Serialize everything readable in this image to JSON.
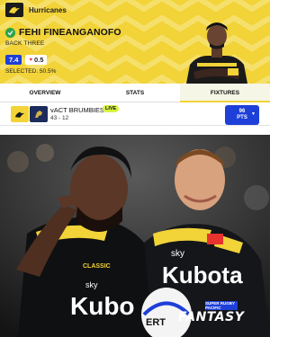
{
  "header": {
    "team_name": "Hurricanes",
    "player_name": "FEHI FINEANGANOFO",
    "position": "BACK THREE",
    "price": "7.4",
    "change": "0.5",
    "selected": "SELECTED: 50.5%",
    "accent_color": "#f2d338"
  },
  "tabs": [
    {
      "label": "OVERVIEW",
      "active": false
    },
    {
      "label": "STATS",
      "active": false
    },
    {
      "label": "FIXTURES",
      "active": true
    }
  ],
  "fixture": {
    "opponent": "vACT BRUMBIES",
    "score": "43 - 12",
    "live_label": "LIVE",
    "points_value": "96",
    "points_unit": "PTS"
  },
  "hero": {
    "brand": "FANTASY",
    "badge": "SUPER RUGBY PACIFIC"
  },
  "icons": {
    "team_logo": "hurricanes-logo-icon",
    "status": "check-icon",
    "change": "heart-icon",
    "expand": "chevron-down-icon"
  }
}
